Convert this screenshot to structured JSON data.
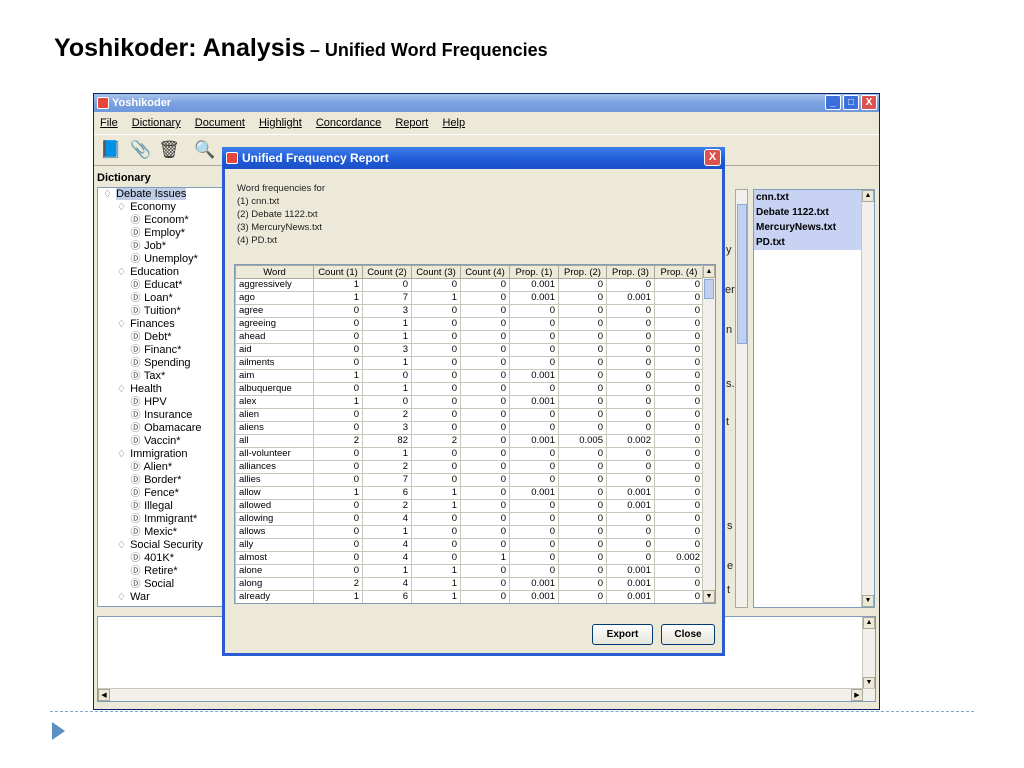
{
  "slide": {
    "title_main": "Yoshikoder: Analysis",
    "title_sub": "– Unified Word Frequencies"
  },
  "window": {
    "title": "Yoshikoder",
    "controls": [
      "_",
      "□",
      "X"
    ],
    "menu": [
      "File",
      "Dictionary",
      "Document",
      "Highlight",
      "Concordance",
      "Report",
      "Help"
    ]
  },
  "dictionary": {
    "label": "Dictionary",
    "tree": [
      {
        "depth": 0,
        "icon": "folder",
        "label": "Debate Issues",
        "selected": true
      },
      {
        "depth": 1,
        "icon": "folder",
        "label": "Economy"
      },
      {
        "depth": 2,
        "icon": "pattern",
        "label": "Econom*"
      },
      {
        "depth": 2,
        "icon": "pattern",
        "label": "Employ*"
      },
      {
        "depth": 2,
        "icon": "pattern",
        "label": "Job*"
      },
      {
        "depth": 2,
        "icon": "pattern",
        "label": "Unemploy*"
      },
      {
        "depth": 1,
        "icon": "folder",
        "label": "Education"
      },
      {
        "depth": 2,
        "icon": "pattern",
        "label": "Educat*"
      },
      {
        "depth": 2,
        "icon": "pattern",
        "label": "Loan*"
      },
      {
        "depth": 2,
        "icon": "pattern",
        "label": "Tuition*"
      },
      {
        "depth": 1,
        "icon": "folder",
        "label": "Finances"
      },
      {
        "depth": 2,
        "icon": "pattern",
        "label": "Debt*"
      },
      {
        "depth": 2,
        "icon": "pattern",
        "label": "Financ*"
      },
      {
        "depth": 2,
        "icon": "pattern",
        "label": "Spending"
      },
      {
        "depth": 2,
        "icon": "pattern",
        "label": "Tax*"
      },
      {
        "depth": 1,
        "icon": "folder",
        "label": "Health"
      },
      {
        "depth": 2,
        "icon": "pattern",
        "label": "HPV"
      },
      {
        "depth": 2,
        "icon": "pattern",
        "label": "Insurance"
      },
      {
        "depth": 2,
        "icon": "pattern",
        "label": "Obamacare"
      },
      {
        "depth": 2,
        "icon": "pattern",
        "label": "Vaccin*"
      },
      {
        "depth": 1,
        "icon": "folder",
        "label": "Immigration"
      },
      {
        "depth": 2,
        "icon": "pattern",
        "label": "Alien*"
      },
      {
        "depth": 2,
        "icon": "pattern",
        "label": "Border*"
      },
      {
        "depth": 2,
        "icon": "pattern",
        "label": "Fence*"
      },
      {
        "depth": 2,
        "icon": "pattern",
        "label": "Illegal"
      },
      {
        "depth": 2,
        "icon": "pattern",
        "label": "Immigrant*"
      },
      {
        "depth": 2,
        "icon": "pattern",
        "label": "Mexic*"
      },
      {
        "depth": 1,
        "icon": "folder",
        "label": "Social Security"
      },
      {
        "depth": 2,
        "icon": "pattern",
        "label": "401K*"
      },
      {
        "depth": 2,
        "icon": "pattern",
        "label": "Retire*"
      },
      {
        "depth": 2,
        "icon": "pattern",
        "label": "Social"
      },
      {
        "depth": 1,
        "icon": "folder",
        "label": "War"
      }
    ]
  },
  "documents": [
    "cnn.txt",
    "Debate 1122.txt",
    "MercuryNews.txt",
    "PD.txt"
  ],
  "background_fragments": [
    "y",
    "er",
    "n",
    "s.",
    "t",
    "s",
    "e",
    "t"
  ],
  "dialog": {
    "title": "Unified Frequency Report",
    "close": "X",
    "heading": "Word frequencies for",
    "sources": [
      "(1)  cnn.txt",
      "(2)  Debate 1122.txt",
      "(3)  MercuryNews.txt",
      "(4)  PD.txt"
    ],
    "columns": [
      "Word",
      "Count (1)",
      "Count (2)",
      "Count (3)",
      "Count (4)",
      "Prop. (1)",
      "Prop. (2)",
      "Prop. (3)",
      "Prop. (4)"
    ],
    "rows": [
      [
        "aggressively",
        "1",
        "0",
        "0",
        "0",
        "0.001",
        "0",
        "0",
        "0"
      ],
      [
        "ago",
        "1",
        "7",
        "1",
        "0",
        "0.001",
        "0",
        "0.001",
        "0"
      ],
      [
        "agree",
        "0",
        "3",
        "0",
        "0",
        "0",
        "0",
        "0",
        "0"
      ],
      [
        "agreeing",
        "0",
        "1",
        "0",
        "0",
        "0",
        "0",
        "0",
        "0"
      ],
      [
        "ahead",
        "0",
        "1",
        "0",
        "0",
        "0",
        "0",
        "0",
        "0"
      ],
      [
        "aid",
        "0",
        "3",
        "0",
        "0",
        "0",
        "0",
        "0",
        "0"
      ],
      [
        "ailments",
        "0",
        "1",
        "0",
        "0",
        "0",
        "0",
        "0",
        "0"
      ],
      [
        "aim",
        "1",
        "0",
        "0",
        "0",
        "0.001",
        "0",
        "0",
        "0"
      ],
      [
        "albuquerque",
        "0",
        "1",
        "0",
        "0",
        "0",
        "0",
        "0",
        "0"
      ],
      [
        "alex",
        "1",
        "0",
        "0",
        "0",
        "0.001",
        "0",
        "0",
        "0"
      ],
      [
        "alien",
        "0",
        "2",
        "0",
        "0",
        "0",
        "0",
        "0",
        "0"
      ],
      [
        "aliens",
        "0",
        "3",
        "0",
        "0",
        "0",
        "0",
        "0",
        "0"
      ],
      [
        "all",
        "2",
        "82",
        "2",
        "0",
        "0.001",
        "0.005",
        "0.002",
        "0"
      ],
      [
        "all-volunteer",
        "0",
        "1",
        "0",
        "0",
        "0",
        "0",
        "0",
        "0"
      ],
      [
        "alliances",
        "0",
        "2",
        "0",
        "0",
        "0",
        "0",
        "0",
        "0"
      ],
      [
        "allies",
        "0",
        "7",
        "0",
        "0",
        "0",
        "0",
        "0",
        "0"
      ],
      [
        "allow",
        "1",
        "6",
        "1",
        "0",
        "0.001",
        "0",
        "0.001",
        "0"
      ],
      [
        "allowed",
        "0",
        "2",
        "1",
        "0",
        "0",
        "0",
        "0.001",
        "0"
      ],
      [
        "allowing",
        "0",
        "4",
        "0",
        "0",
        "0",
        "0",
        "0",
        "0"
      ],
      [
        "allows",
        "0",
        "1",
        "0",
        "0",
        "0",
        "0",
        "0",
        "0"
      ],
      [
        "ally",
        "0",
        "4",
        "0",
        "0",
        "0",
        "0",
        "0",
        "0"
      ],
      [
        "almost",
        "0",
        "4",
        "0",
        "1",
        "0",
        "0",
        "0",
        "0.002"
      ],
      [
        "alone",
        "0",
        "1",
        "1",
        "0",
        "0",
        "0",
        "0.001",
        "0"
      ],
      [
        "along",
        "2",
        "4",
        "1",
        "0",
        "0.001",
        "0",
        "0.001",
        "0"
      ],
      [
        "already",
        "1",
        "6",
        "1",
        "0",
        "0.001",
        "0",
        "0.001",
        "0"
      ]
    ],
    "export_label": "Export",
    "close_label": "Close"
  }
}
